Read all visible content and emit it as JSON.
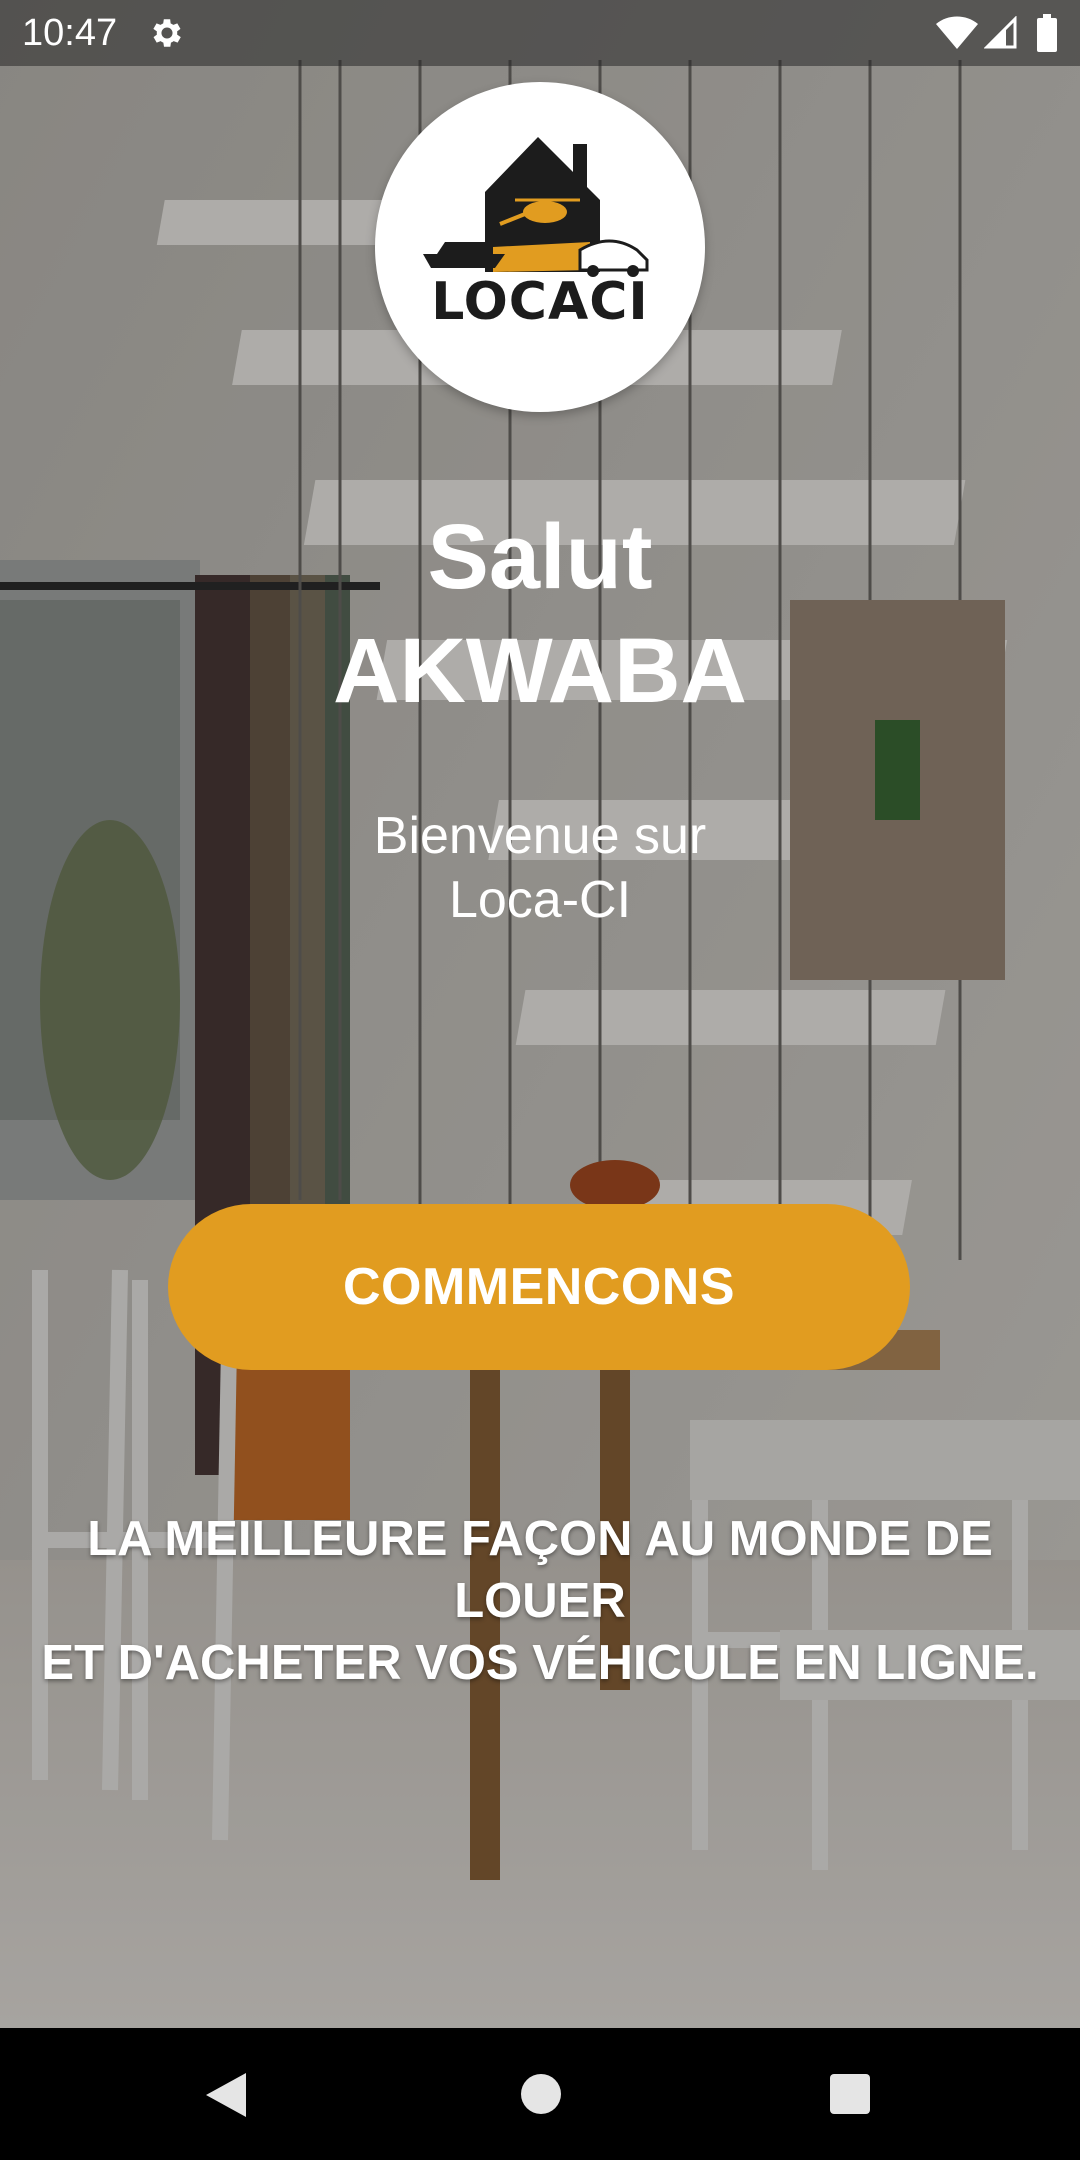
{
  "status_bar": {
    "time": "10:47",
    "icons": [
      "gear-icon",
      "wifi-icon",
      "signal-icon",
      "battery-icon"
    ]
  },
  "logo": {
    "text": "LOCACI",
    "colors": {
      "accent": "#e19c20",
      "dark": "#1c1c1c"
    }
  },
  "greeting": {
    "line1": "Salut",
    "line2": "AKWABA"
  },
  "welcome": {
    "line1": "Bienvenue sur",
    "line2": "Loca-CI"
  },
  "start_button": {
    "label": "COMMENCONS",
    "color": "#e19c20"
  },
  "tagline": {
    "line1": "LA MEILLEURE FAÇON AU MONDE DE LOUER",
    "line2": "ET D'ACHETER VOS VÉHICULE EN LIGNE."
  },
  "nav_bar": {
    "icons": [
      "back-icon",
      "home-icon",
      "recents-icon"
    ]
  }
}
